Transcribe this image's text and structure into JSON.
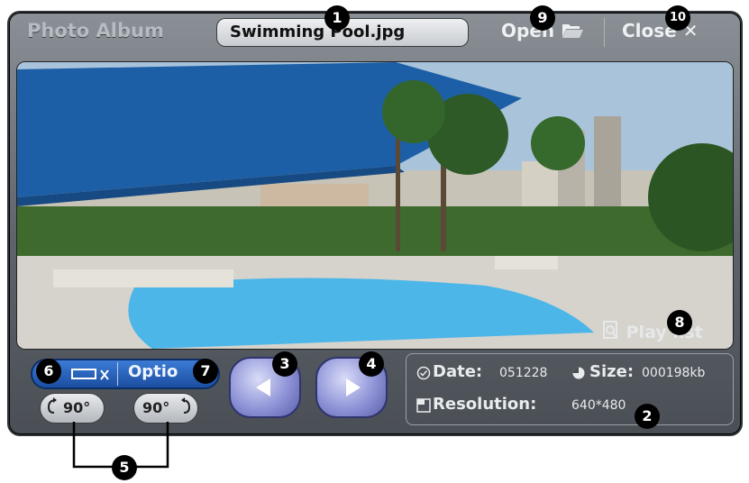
{
  "app": {
    "title": "Photo Album",
    "filename": "Swimming Pool.jpg"
  },
  "header": {
    "open_label": "Open",
    "close_label": "Close"
  },
  "controls": {
    "option_label": "Optio",
    "rotate_left_label": "90°",
    "rotate_right_label": "90°"
  },
  "playlist": {
    "label": "Play list"
  },
  "info": {
    "date_label": "Date:",
    "date_value": "051228",
    "size_label": "Size:",
    "size_value": "000198kb",
    "resolution_label": "Resolution:",
    "resolution_value": "640*480"
  },
  "callouts": [
    "1",
    "2",
    "3",
    "4",
    "5",
    "6",
    "7",
    "8",
    "9",
    "10"
  ],
  "colors": {
    "frame": "#5d6369",
    "accent_blue": "#1b4ea0",
    "nav_button": "#8e93d7"
  }
}
